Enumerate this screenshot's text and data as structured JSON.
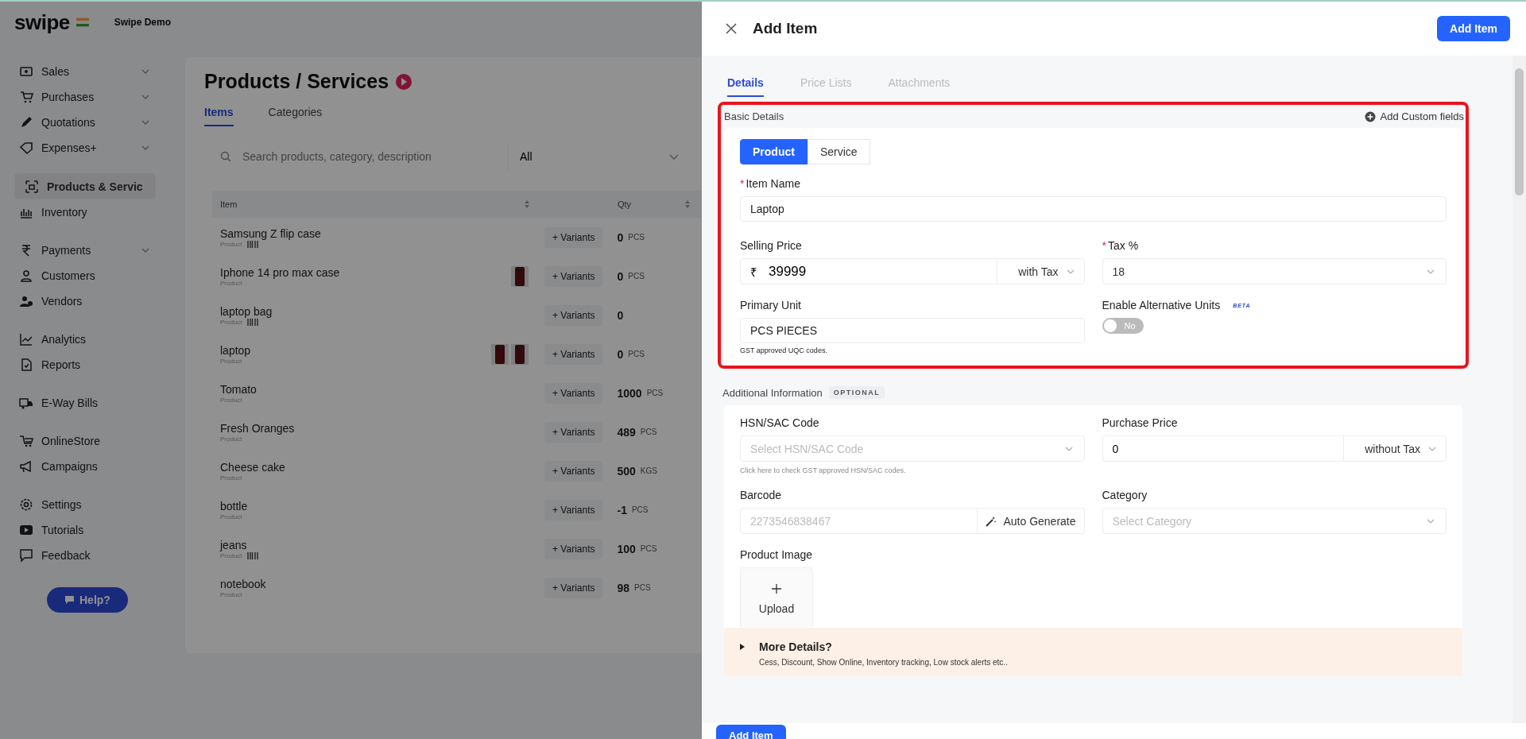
{
  "sidebar": {
    "logo": "swipe",
    "company": "Swipe Demo",
    "groups": [
      [
        {
          "label": "Sales",
          "expandable": true,
          "selected": false
        },
        {
          "label": "Purchases",
          "expandable": true,
          "selected": false
        },
        {
          "label": "Quotations",
          "expandable": true,
          "selected": false
        },
        {
          "label": "Expenses+",
          "expandable": true,
          "selected": false
        }
      ],
      [
        {
          "label": "Products & Servic",
          "expandable": false,
          "selected": true
        },
        {
          "label": "Inventory",
          "expandable": false,
          "selected": false
        }
      ],
      [
        {
          "label": "Payments",
          "expandable": true,
          "selected": false
        },
        {
          "label": "Customers",
          "expandable": false,
          "selected": false
        },
        {
          "label": "Vendors",
          "expandable": false,
          "selected": false
        }
      ],
      [
        {
          "label": "Analytics",
          "expandable": false,
          "selected": false
        },
        {
          "label": "Reports",
          "expandable": false,
          "selected": false
        }
      ],
      [
        {
          "label": "E-Way Bills",
          "expandable": false,
          "selected": false
        }
      ],
      [
        {
          "label": "OnlineStore",
          "expandable": false,
          "selected": false
        },
        {
          "label": "Campaigns",
          "expandable": false,
          "selected": false
        }
      ],
      [
        {
          "label": "Settings",
          "expandable": false,
          "selected": false
        },
        {
          "label": "Tutorials",
          "expandable": false,
          "selected": false
        },
        {
          "label": "Feedback",
          "expandable": false,
          "selected": false
        }
      ]
    ],
    "help_button": "Help?"
  },
  "page": {
    "title": "Products / Services",
    "tabs": [
      {
        "label": "Items",
        "selected": true
      },
      {
        "label": "Categories",
        "selected": false
      }
    ],
    "search": {
      "placeholder": "Search products, category, description"
    },
    "filter": {
      "value": "All"
    },
    "table": {
      "columns": [
        "Item",
        "Qty"
      ],
      "rows": [
        {
          "name": "Samsung Z flip case",
          "subtitle": "Product",
          "barcode": true,
          "images": [],
          "variants": "+ Variants",
          "qty": "0",
          "unit": "PCS"
        },
        {
          "name": "Iphone 14 pro max case",
          "subtitle": "Product",
          "barcode": false,
          "variants": "+ Variants",
          "qty": "0",
          "unit": "PCS"
        },
        {
          "name": "laptop bag",
          "subtitle": "Product",
          "barcode": true,
          "images": [],
          "variants": "+ Variants",
          "qty": "0",
          "unit": ""
        },
        {
          "name": "laptop",
          "subtitle": "Product",
          "barcode": false,
          "variants": "+ Variants",
          "qty": "0",
          "unit": "PCS"
        },
        {
          "name": "Tomato",
          "subtitle": "Product",
          "barcode": false,
          "images": [],
          "variants": "+ Variants",
          "qty": "1000",
          "unit": "PCS"
        },
        {
          "name": "Fresh Oranges",
          "subtitle": "Product",
          "barcode": false,
          "images": [],
          "variants": "+ Variants",
          "qty": "489",
          "unit": "PCS"
        },
        {
          "name": "Cheese cake",
          "subtitle": "Product",
          "barcode": false,
          "images": [],
          "variants": "+ Variants",
          "qty": "500",
          "unit": "KGS"
        },
        {
          "name": "bottle",
          "subtitle": "Product",
          "barcode": false,
          "images": [],
          "variants": "+ Variants",
          "qty": "-1",
          "unit": "PCS"
        },
        {
          "name": "jeans",
          "subtitle": "Product",
          "barcode": true,
          "images": [],
          "variants": "+ Variants",
          "qty": "100",
          "unit": "PCS"
        },
        {
          "name": "notebook",
          "subtitle": "Product",
          "barcode": false,
          "images": [],
          "variants": "+ Variants",
          "qty": "98",
          "unit": "PCS"
        }
      ]
    }
  },
  "drawer": {
    "title": "Add Item",
    "header_button": "Add Item",
    "tabs": [
      {
        "label": "Details",
        "selected": true
      },
      {
        "label": "Price Lists",
        "selected": false
      },
      {
        "label": "Attachments",
        "selected": false
      }
    ],
    "basic_details": {
      "heading": "Basic Details",
      "highlighted": true,
      "custom_fields_link": "Add Custom fields",
      "type_toggle": [
        {
          "label": "Product",
          "selected": true
        },
        {
          "label": "Service",
          "selected": false
        }
      ],
      "item_name": {
        "label": "Item Name",
        "required_mark": "*",
        "value": "Laptop"
      },
      "selling_price": {
        "label": "Selling Price",
        "currency": "₹",
        "value": "39999",
        "tax_mode": "with Tax"
      },
      "tax": {
        "label": "Tax %",
        "required_mark": "*",
        "value": "18"
      },
      "primary_unit": {
        "label": "Primary Unit",
        "value": "PCS PIECES",
        "hint": "GST approved UQC codes."
      },
      "alternative_units": {
        "label": "Enable Alternative Units",
        "badge": "BETA",
        "on": false,
        "toggle_text": "No"
      }
    },
    "additional_info": {
      "heading": "Additional Information",
      "badge": "OPTIONAL",
      "hsn": {
        "label": "HSN/SAC Code",
        "placeholder": "Select HSN/SAC Code",
        "hint": "Click here to check GST approved HSN/SAC codes."
      },
      "purchase_price": {
        "label": "Purchase Price",
        "value": "0",
        "tax_mode": "without Tax"
      },
      "barcode": {
        "label": "Barcode",
        "placeholder": "2273546838467",
        "button": "Auto Generate"
      },
      "category": {
        "label": "Category",
        "placeholder": "Select Category"
      },
      "product_image": {
        "label": "Product Image",
        "upload": "Upload"
      },
      "more_details": {
        "title": "More Details?",
        "description": "Cess, Discount, Show Online, Inventory tracking, Low stock alerts etc..",
        "expanded": false
      }
    },
    "footer_button": "Add Item"
  }
}
